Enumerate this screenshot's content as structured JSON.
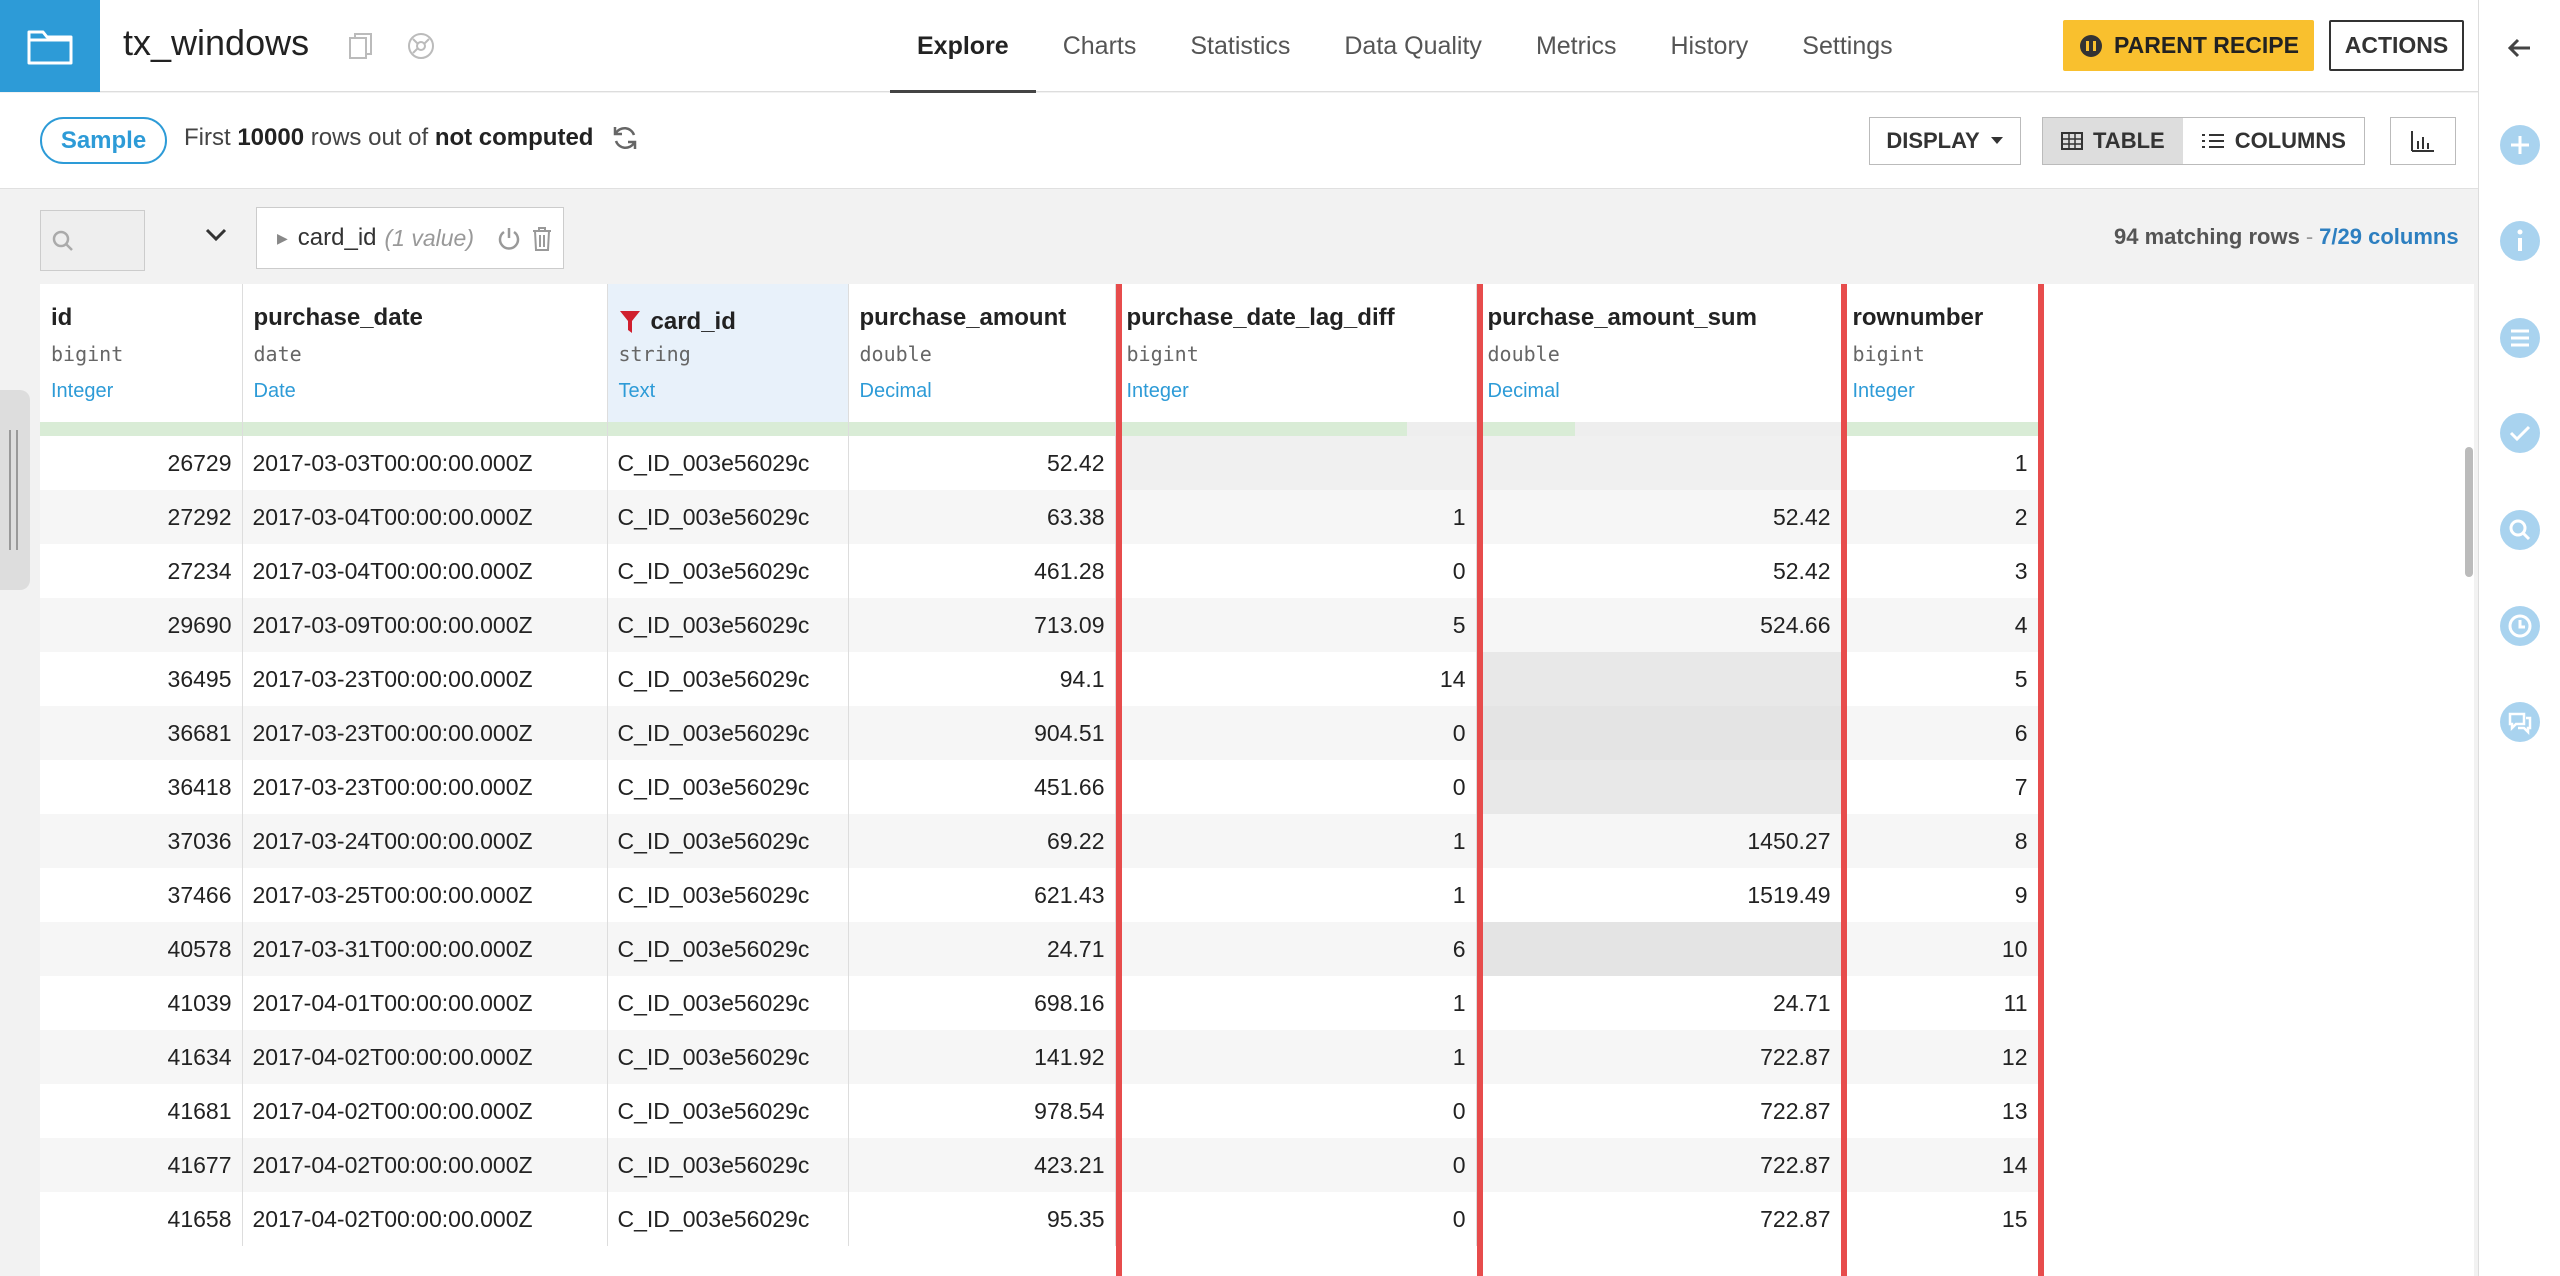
{
  "dataset": {
    "name": "tx_windows"
  },
  "nav": {
    "tabs": [
      "Explore",
      "Charts",
      "Statistics",
      "Data Quality",
      "Metrics",
      "History",
      "Settings"
    ]
  },
  "buttons": {
    "parent_recipe": "PARENT RECIPE",
    "actions": "ACTIONS",
    "display": "DISPLAY",
    "table": "TABLE",
    "columns": "COLUMNS"
  },
  "sample": {
    "pill": "Sample",
    "prefix": "First",
    "rows": "10000",
    "middle": "rows out of",
    "total": "not computed"
  },
  "filter": {
    "search_value": "",
    "column": "card_id",
    "value_count": "(1 value)"
  },
  "status": {
    "matching": "94 matching rows",
    "separator": "-",
    "columns": "7/29 columns"
  },
  "colors": {
    "accent": "#2d9bd7",
    "parent_recipe": "#f9c02e",
    "highlight": "#e74c4c",
    "filter_icon": "#d0202e"
  },
  "table": {
    "columns": [
      {
        "name": "id",
        "type": "bigint",
        "meaning": "Integer"
      },
      {
        "name": "purchase_date",
        "type": "date",
        "meaning": "Date"
      },
      {
        "name": "card_id",
        "type": "string",
        "meaning": "Text"
      },
      {
        "name": "purchase_amount",
        "type": "double",
        "meaning": "Decimal"
      },
      {
        "name": "purchase_date_lag_diff",
        "type": "bigint",
        "meaning": "Integer"
      },
      {
        "name": "purchase_amount_sum",
        "type": "double",
        "meaning": "Decimal"
      },
      {
        "name": "rownumber",
        "type": "bigint",
        "meaning": "Integer"
      }
    ],
    "rows": [
      [
        "26729",
        "2017-03-03T00:00:00.000Z",
        "C_ID_003e56029c",
        "52.42",
        "",
        "",
        "1"
      ],
      [
        "27292",
        "2017-03-04T00:00:00.000Z",
        "C_ID_003e56029c",
        "63.38",
        "1",
        "52.42",
        "2"
      ],
      [
        "27234",
        "2017-03-04T00:00:00.000Z",
        "C_ID_003e56029c",
        "461.28",
        "0",
        "52.42",
        "3"
      ],
      [
        "29690",
        "2017-03-09T00:00:00.000Z",
        "C_ID_003e56029c",
        "713.09",
        "5",
        "524.66",
        "4"
      ],
      [
        "36495",
        "2017-03-23T00:00:00.000Z",
        "C_ID_003e56029c",
        "94.1",
        "14",
        "",
        "5"
      ],
      [
        "36681",
        "2017-03-23T00:00:00.000Z",
        "C_ID_003e56029c",
        "904.51",
        "0",
        "",
        "6"
      ],
      [
        "36418",
        "2017-03-23T00:00:00.000Z",
        "C_ID_003e56029c",
        "451.66",
        "0",
        "",
        "7"
      ],
      [
        "37036",
        "2017-03-24T00:00:00.000Z",
        "C_ID_003e56029c",
        "69.22",
        "1",
        "1450.27",
        "8"
      ],
      [
        "37466",
        "2017-03-25T00:00:00.000Z",
        "C_ID_003e56029c",
        "621.43",
        "1",
        "1519.49",
        "9"
      ],
      [
        "40578",
        "2017-03-31T00:00:00.000Z",
        "C_ID_003e56029c",
        "24.71",
        "6",
        "",
        "10"
      ],
      [
        "41039",
        "2017-04-01T00:00:00.000Z",
        "C_ID_003e56029c",
        "698.16",
        "1",
        "24.71",
        "11"
      ],
      [
        "41634",
        "2017-04-02T00:00:00.000Z",
        "C_ID_003e56029c",
        "141.92",
        "1",
        "722.87",
        "12"
      ],
      [
        "41681",
        "2017-04-02T00:00:00.000Z",
        "C_ID_003e56029c",
        "978.54",
        "0",
        "722.87",
        "13"
      ],
      [
        "41677",
        "2017-04-02T00:00:00.000Z",
        "C_ID_003e56029c",
        "423.21",
        "0",
        "722.87",
        "14"
      ],
      [
        "41658",
        "2017-04-02T00:00:00.000Z",
        "C_ID_003e56029c",
        "95.35",
        "0",
        "722.87",
        "15"
      ]
    ]
  }
}
